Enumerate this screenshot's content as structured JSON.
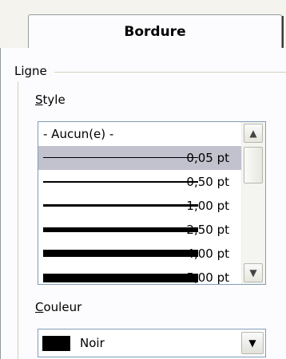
{
  "tab": {
    "label": "Bordure"
  },
  "group": {
    "title": "Ligne"
  },
  "style_field": {
    "label_mnemonic": "S",
    "label_rest": "tyle"
  },
  "style_list": {
    "items": [
      {
        "label": "- Aucun(e) -",
        "thickness": 0
      },
      {
        "label": "0,05 pt",
        "thickness": 0.05,
        "selected": true
      },
      {
        "label": "0,50 pt",
        "thickness": 0.5
      },
      {
        "label": "1,00 pt",
        "thickness": 1.0
      },
      {
        "label": "2,50 pt",
        "thickness": 2.5
      },
      {
        "label": "4,00 pt",
        "thickness": 4.0
      },
      {
        "label": "5,00 pt",
        "thickness": 5.0
      }
    ],
    "scroll_up_icon": "▲",
    "scroll_down_icon": "▼"
  },
  "color_field": {
    "label_mnemonic": "C",
    "label_rest": "ouleur",
    "value": "Noir",
    "swatch_color": "#000000",
    "dropdown_icon": "▼"
  }
}
